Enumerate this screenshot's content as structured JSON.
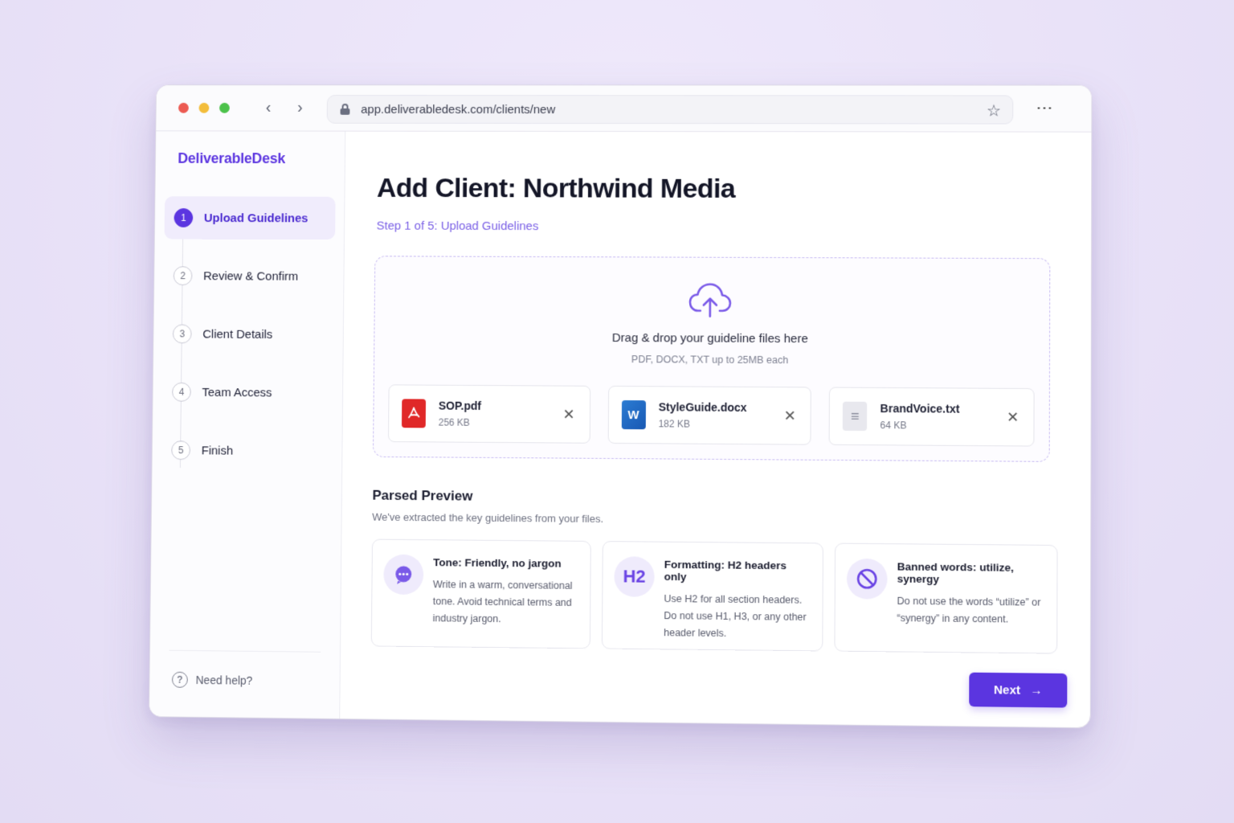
{
  "browser": {
    "url": "app.deliverabledesk.com/clients/new"
  },
  "sidebar": {
    "brand": "DeliverableDesk",
    "steps": [
      {
        "num": "1",
        "label": "Upload Guidelines",
        "active": true
      },
      {
        "num": "2",
        "label": "Review & Confirm",
        "active": false
      },
      {
        "num": "3",
        "label": "Client Details",
        "active": false
      },
      {
        "num": "4",
        "label": "Team Access",
        "active": false
      },
      {
        "num": "5",
        "label": "Finish",
        "active": false
      }
    ],
    "help_label": "Need help?"
  },
  "main": {
    "title": "Add Client: Northwind Media",
    "subtitle": "Step 1 of 5: Upload Guidelines",
    "dropzone": {
      "title": "Drag & drop your guideline files here",
      "hint": "PDF, DOCX, TXT up to 25MB each"
    },
    "files": [
      {
        "name": "SOP.pdf",
        "size": "256 KB",
        "type": "pdf-icon"
      },
      {
        "name": "StyleGuide.docx",
        "size": "182 KB",
        "type": "word-doc-icon"
      },
      {
        "name": "BrandVoice.txt",
        "size": "64 KB",
        "type": "text-file-icon"
      }
    ],
    "preview": {
      "title": "Parsed Preview",
      "subtitle": "We've extracted the key guidelines from your files.",
      "cards": [
        {
          "icon": "chat-bubble-icon",
          "title": "Tone: Friendly, no jargon",
          "body": "Write in a warm, conversational tone. Avoid technical terms and industry jargon."
        },
        {
          "icon": "h2-heading-icon",
          "icon_text": "H2",
          "title": "Formatting: H2 headers only",
          "body": "Use H2 for all section headers. Do not use H1, H3, or any other header levels."
        },
        {
          "icon": "prohibited-icon",
          "title": "Banned words: utilize, synergy",
          "body": "Do not use the words “utilize” or “synergy” in any content."
        }
      ]
    },
    "next_label": "Next"
  },
  "colors": {
    "accent": "#5b35e0",
    "accent_light": "#efebfc",
    "pdf_red": "#e02828",
    "word_blue": "#2b7cd3"
  }
}
